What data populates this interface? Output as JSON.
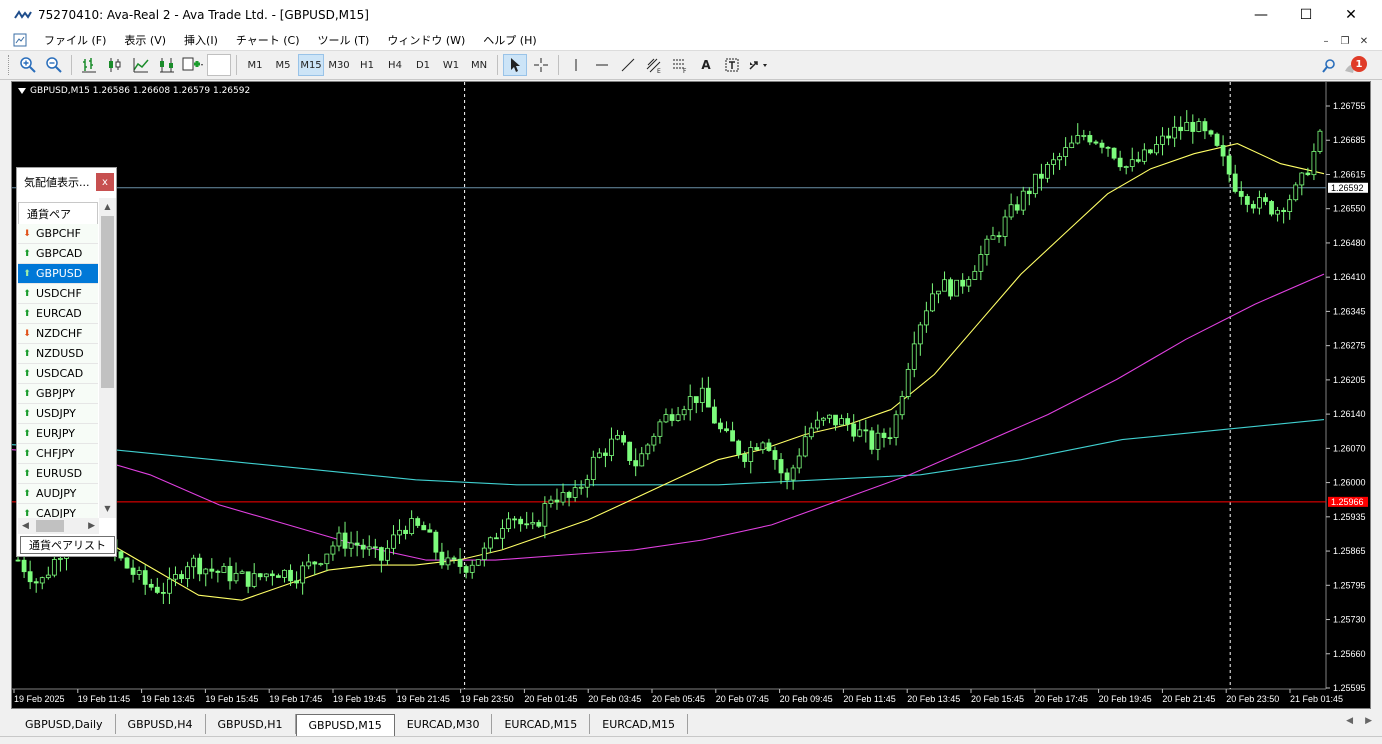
{
  "window": {
    "title": "75270410: Ava-Real 2 - Ava Trade Ltd. - [GBPUSD,M15]",
    "minimize": "—",
    "maximize": "☐",
    "close": "✕"
  },
  "menu": [
    "ファイル (F)",
    "表示 (V)",
    "挿入(I)",
    "チャート (C)",
    "ツール (T)",
    "ウィンドウ (W)",
    "ヘルプ (H)"
  ],
  "toolbar": {
    "timeframes": [
      "M1",
      "M5",
      "M15",
      "M30",
      "H1",
      "H4",
      "D1",
      "W1",
      "MN"
    ],
    "active_timeframe": "M15",
    "notification_count": "1"
  },
  "chart": {
    "header": "GBPUSD,M15  1.26586 1.26608 1.26579 1.26592",
    "current_price_label": "1.26592",
    "red_line_label": "1.25966"
  },
  "chart_data": {
    "type": "candlestick",
    "symbol": "GBPUSD",
    "timeframe": "M15",
    "y_ticks": [
      "1.26755",
      "1.26685",
      "1.26615",
      "1.26550",
      "1.26480",
      "1.26410",
      "1.26345",
      "1.26275",
      "1.26205",
      "1.26140",
      "1.26070",
      "1.26000",
      "1.25935",
      "1.25865",
      "1.25795",
      "1.25730",
      "1.25660",
      "1.25595"
    ],
    "ylim": [
      1.25595,
      1.26755
    ],
    "x_ticks": [
      "19 Feb 2025",
      "19 Feb 11:45",
      "19 Feb 13:45",
      "19 Feb 15:45",
      "19 Feb 17:45",
      "19 Feb 19:45",
      "19 Feb 21:45",
      "19 Feb 23:50",
      "20 Feb 01:45",
      "20 Feb 03:45",
      "20 Feb 05:45",
      "20 Feb 07:45",
      "20 Feb 09:45",
      "20 Feb 11:45",
      "20 Feb 13:45",
      "20 Feb 15:45",
      "20 Feb 17:45",
      "20 Feb 19:45",
      "20 Feb 21:45",
      "20 Feb 23:50",
      "21 Feb 01:45"
    ],
    "current_price": 1.26592,
    "red_line": 1.25966,
    "colors": {
      "background": "#000000",
      "candle": "#7CFC7C",
      "ma_fast": "#FFFF66",
      "ma_mid": "#E040E0",
      "ma_slow": "#40D0D0",
      "price_line": "#6a8fa8",
      "red_line": "#FF0000"
    },
    "close_path": [
      1.2585,
      1.258,
      1.2587,
      1.2592,
      1.2589,
      1.2584,
      1.258,
      1.2579,
      1.2585,
      1.2583,
      1.2582,
      1.2581,
      1.2583,
      1.2582,
      1.2585,
      1.2589,
      1.2588,
      1.2585,
      1.2592,
      1.2591,
      1.2584,
      1.2584,
      1.2587,
      1.2595,
      1.259,
      1.2598,
      1.2597,
      1.2605,
      1.2609,
      1.2604,
      1.2612,
      1.2616,
      1.2618,
      1.261,
      1.2606,
      1.261,
      1.26,
      1.2611,
      1.2613,
      1.2612,
      1.2608,
      1.2611,
      1.263,
      1.264,
      1.2639,
      1.2645,
      1.2651,
      1.2657,
      1.2662,
      1.2666,
      1.267,
      1.2668,
      1.2663,
      1.2666,
      1.267,
      1.2672,
      1.2668,
      1.266,
      1.2656,
      1.2655,
      1.2659,
      1.2669
    ],
    "ma_fast_path": [
      1.2588,
      1.2583,
      1.2578,
      1.2577,
      1.258,
      1.2583,
      1.2584,
      1.2584,
      1.2585,
      1.2587,
      1.259,
      1.2593,
      1.2597,
      1.2601,
      1.2605,
      1.2607,
      1.261,
      1.2612,
      1.2615,
      1.2622,
      1.2632,
      1.2642,
      1.265,
      1.2658,
      1.2663,
      1.2666,
      1.2668,
      1.2664,
      1.2662
    ],
    "ma_mid_path": [
      1.2607,
      1.2606,
      1.2602,
      1.2596,
      1.2592,
      1.2588,
      1.2585,
      1.2585,
      1.2586,
      1.2587,
      1.2589,
      1.2592,
      1.2597,
      1.2602,
      1.2608,
      1.2614,
      1.2621,
      1.2629,
      1.2636,
      1.2642
    ],
    "ma_slow_path": [
      1.2608,
      1.2607,
      1.2605,
      1.2603,
      1.2601,
      1.26,
      1.26,
      1.26,
      1.2601,
      1.2602,
      1.2605,
      1.2609,
      1.2611,
      1.2613
    ],
    "vertical_markers": [
      "19 Feb 23:50",
      "20 Feb 23:50"
    ]
  },
  "market_watch": {
    "title": "気配値表示...",
    "close": "x",
    "column_header": "通貨ペア",
    "items": [
      {
        "symbol": "GBPCHF",
        "dir": "down"
      },
      {
        "symbol": "GBPCAD",
        "dir": "up"
      },
      {
        "symbol": "GBPUSD",
        "dir": "up",
        "selected": true
      },
      {
        "symbol": "USDCHF",
        "dir": "up"
      },
      {
        "symbol": "EURCAD",
        "dir": "up"
      },
      {
        "symbol": "NZDCHF",
        "dir": "down"
      },
      {
        "symbol": "NZDUSD",
        "dir": "up"
      },
      {
        "symbol": "USDCAD",
        "dir": "up"
      },
      {
        "symbol": "GBPJPY",
        "dir": "up"
      },
      {
        "symbol": "USDJPY",
        "dir": "up"
      },
      {
        "symbol": "EURJPY",
        "dir": "up"
      },
      {
        "symbol": "CHFJPY",
        "dir": "up"
      },
      {
        "symbol": "EURUSD",
        "dir": "up"
      },
      {
        "symbol": "AUDJPY",
        "dir": "up"
      },
      {
        "symbol": "CADJPY",
        "dir": "up"
      }
    ],
    "tab": "通貨ペアリスト"
  },
  "chart_tabs": [
    {
      "label": "GBPUSD,Daily",
      "active": false
    },
    {
      "label": "GBPUSD,H4",
      "active": false
    },
    {
      "label": "GBPUSD,H1",
      "active": false
    },
    {
      "label": "GBPUSD,M15",
      "active": true
    },
    {
      "label": "EURCAD,M30",
      "active": false
    },
    {
      "label": "EURCAD,M15",
      "active": false
    },
    {
      "label": "EURCAD,M15",
      "active": false
    }
  ]
}
